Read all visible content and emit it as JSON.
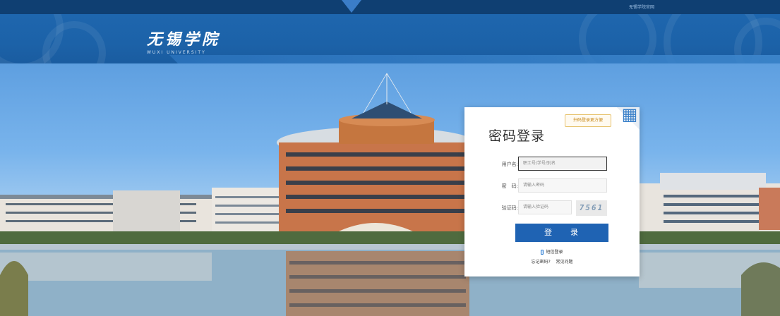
{
  "topbar": {
    "link": "无锡学院官网"
  },
  "header": {
    "school_name_cn": "无锡学院",
    "school_name_en": "WUXI UNIVERSITY"
  },
  "login": {
    "title": "密码登录",
    "qr_tip": "扫码登录更方便",
    "username_label": "用户名:",
    "username_placeholder": "职工号/学号/别名",
    "password_label": "密　码:",
    "password_placeholder": "请输入密码",
    "captcha_label": "验证码:",
    "captcha_placeholder": "请输入验证码",
    "captcha_text": "7561",
    "login_button": "登录",
    "sms_login": "短信登录",
    "forgot_password": "忘记密码?",
    "faq": "常见问题"
  },
  "colors": {
    "brand_blue": "#1f63b3",
    "header_blue": "#1c62a8"
  },
  "icons": {
    "qr": "qr-code-icon",
    "sms": "phone-icon",
    "top_tab": "down-arrow-icon"
  }
}
